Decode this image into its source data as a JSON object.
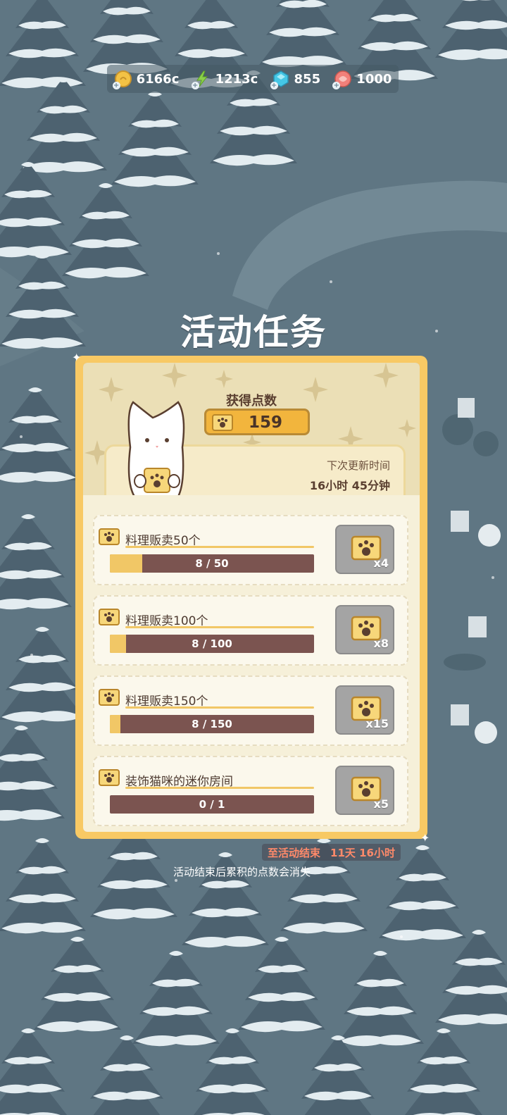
{
  "currency": [
    {
      "name": "gold-coin",
      "value": "6166c",
      "color": "#f3c245"
    },
    {
      "name": "energy",
      "value": "1213c",
      "color": "#8bd14a"
    },
    {
      "name": "gem",
      "value": "855",
      "color": "#45c7e6"
    },
    {
      "name": "fish-ball",
      "value": "1000",
      "color": "#f2807a"
    }
  ],
  "title": "活动任务",
  "points": {
    "label": "获得点数",
    "value": "159"
  },
  "timer": {
    "label": "下次更新时间",
    "value": "16小时 45分钟"
  },
  "tasks": [
    {
      "name": "料理贩卖50个",
      "progress_text": "8 / 50",
      "progress": 0.16,
      "reward": "x4"
    },
    {
      "name": "料理贩卖100个",
      "progress_text": "8 / 100",
      "progress": 0.08,
      "reward": "x8"
    },
    {
      "name": "料理贩卖150个",
      "progress_text": "8 / 150",
      "progress": 0.053,
      "reward": "x15"
    },
    {
      "name": "装饰猫咪的迷你房间",
      "progress_text": "0 / 1",
      "progress": 0.0,
      "reward": "x5"
    }
  ],
  "deadline": {
    "label": "至活动结束",
    "value": "11天 16小时"
  },
  "warning": "活动结束后累积的点数会消失"
}
